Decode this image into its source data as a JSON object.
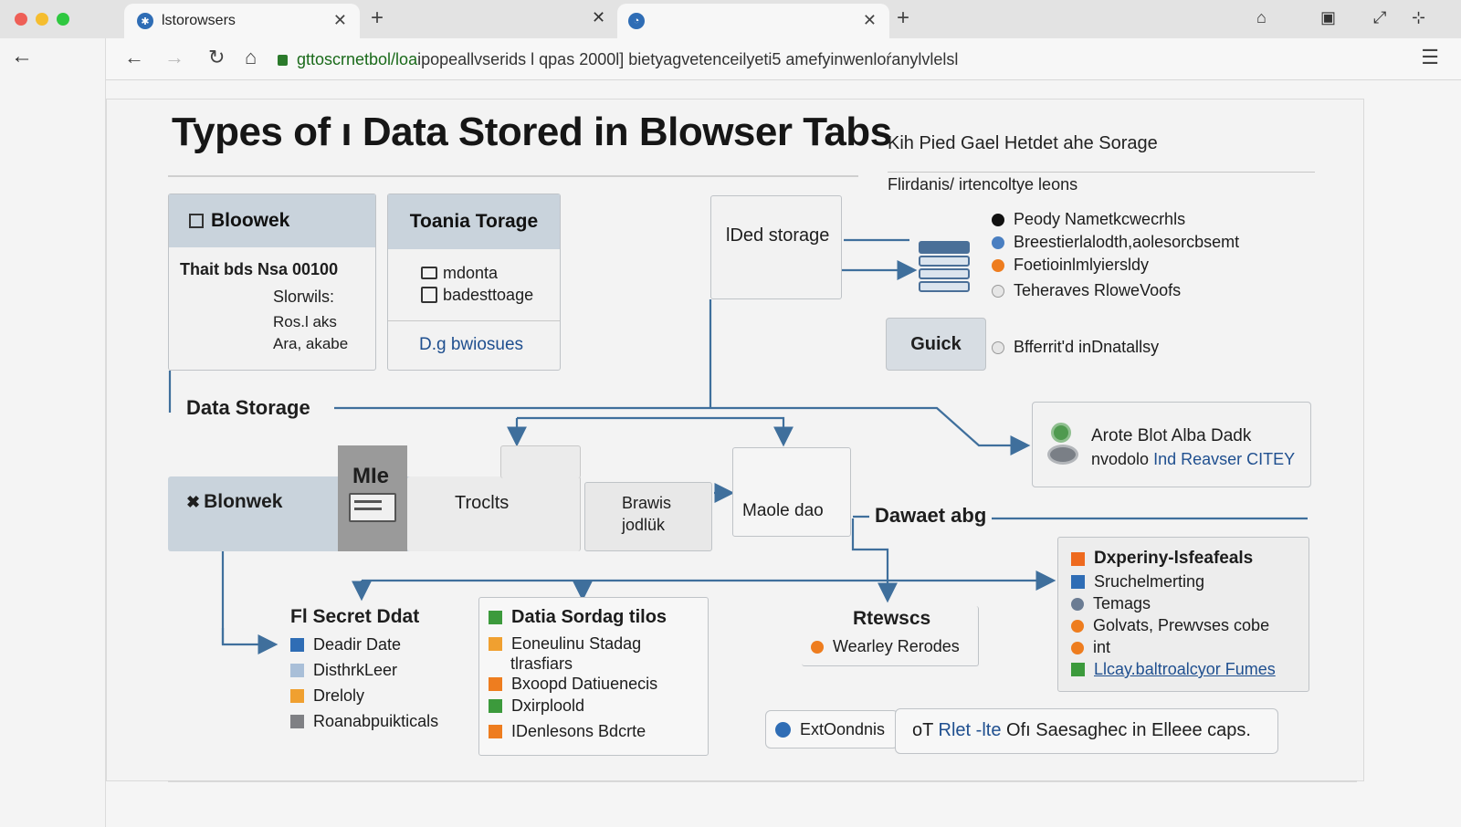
{
  "browser": {
    "tab_title": "lstorowsers",
    "tab2_title": "",
    "url_host": "gttoscrnetbol/loa",
    "url_rest": " ipopeallvserids l qpas 2000l] bietyagvetenceilyeti5 amefyinwenloŕanylvlelsl"
  },
  "title": "Types of ı Data Stored in Blowser Tabs",
  "subtitle_right": "Kih Pied Gael Hetdet ahe Sorage",
  "subtitle_right2": "Flirdanis/ irtencoltye leons",
  "box_bloowek": {
    "header": "Bloowek",
    "line1": "Thait bds Nsa 00100",
    "line2": "Slorwils:",
    "line3": "Ros.l aks",
    "line4": "Ara, akabe"
  },
  "box_toania": {
    "header": "Toania Torage",
    "item1": "mdonta",
    "item2": "badesttoage",
    "link": "D.g bwiosues"
  },
  "box_ded": {
    "label": "lDed storage"
  },
  "legend_top": [
    {
      "label": "Peody Nametkcwecrhls",
      "color": "#111111"
    },
    {
      "label": "Breestierlalodth,aolesorcbsemt",
      "color": "#4a7fc1"
    },
    {
      "label": "Foetioinlmlyiersldy",
      "color": "#ee7d1f"
    },
    {
      "label": "Teheraves RloweVoofs",
      "color": "#e6e6e6"
    }
  ],
  "guick": {
    "label": "Guick",
    "note": "Bfferrit'd inDnatallsy"
  },
  "data_storage_label": "Data Storage",
  "box_arote": {
    "line1": "Arote Blot Alba Dadk",
    "line2_a": "nvodolo ",
    "line2_b": "Ind Reavser CITEY"
  },
  "row_blonwek": {
    "label": "Blonwek",
    "mie_label": "MIe",
    "troclts": "Troclts",
    "brawis_line1": "Brawis",
    "brawis_line2": "jodlük",
    "maole": "Maole dao"
  },
  "dawaet_label": "Dawaet abg",
  "secret": {
    "header": "Fl Secret Ddat",
    "items": [
      {
        "label": "Deadir Date",
        "color": "#2f6db5"
      },
      {
        "label": "DisthrkLeer",
        "color": "#a9bfd8"
      },
      {
        "label": "Dreloly",
        "color": "#f0a030"
      },
      {
        "label": "Roanabpuikticals",
        "color": "#7f8084"
      }
    ]
  },
  "datia": {
    "header": "Datia Sordag tilos",
    "items": [
      {
        "label": "Eoneulinu Stadag",
        "color": "#f0a030"
      },
      {
        "label": "tlrasfiars",
        "color": ""
      },
      {
        "label": "Bxoopd Datiuenecis",
        "color": "#ee7d1f"
      },
      {
        "label": "Dxirploold",
        "color": "#3c9a3c"
      },
      {
        "label": "IDenlesons Bdcrte",
        "color": "#ee7d1f"
      }
    ]
  },
  "rtewscs": {
    "header": "Rtewscs",
    "item": "Wearley Rerodes",
    "item_color": "#ee7d1f"
  },
  "experiny": {
    "header": "Dxperiny-lsfeafeals",
    "items": [
      {
        "label": "Sruchelmerting",
        "color": "#2f6db5",
        "shape": "square"
      },
      {
        "label": "Temags",
        "color": "#6b7c93",
        "shape": "circle"
      },
      {
        "label": "Golvats, Prewvses cobe",
        "color": "#ee7d1f",
        "shape": "circle"
      },
      {
        "label": "int",
        "color": "#ee7d1f",
        "shape": "circle"
      },
      {
        "label": "Llcay.baltroalcyor Fumes",
        "color": "#3c9a3c",
        "shape": "square"
      }
    ],
    "header_color": "#ee6a1f"
  },
  "bottom": {
    "chip_label": "ExtOondnis",
    "caption_a": "oT ",
    "caption_b": "Rlet -lte",
    "caption_c": " Ofı Saesaghec in Elleee caps."
  },
  "colors": {
    "accent": "#2f6db5",
    "header_fill": "#c9d3dc",
    "connector": "#3f6f9c"
  },
  "icons": [
    "globe-icon",
    "close-icon",
    "plus-icon",
    "home-icon",
    "back-arrow-icon",
    "forward-arrow-icon",
    "reload-icon",
    "lock-icon",
    "menu-icon",
    "database-icon",
    "server-icon",
    "cog-icon"
  ]
}
